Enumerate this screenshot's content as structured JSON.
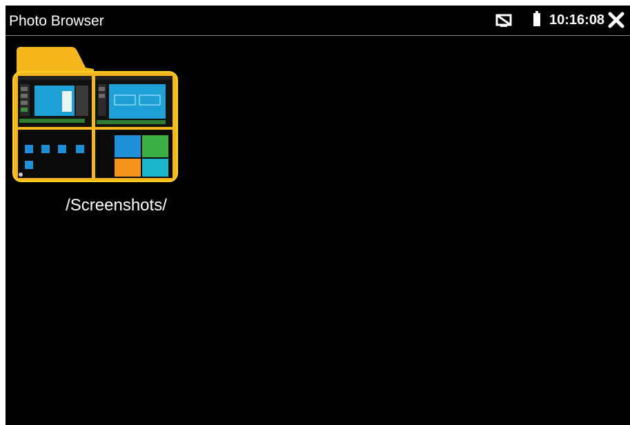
{
  "titlebar": {
    "title": "Photo Browser",
    "clock": "10:16:08",
    "icons": {
      "cast": "screen-cast-off-icon",
      "battery": "battery-icon",
      "close": "close-icon"
    }
  },
  "browser": {
    "folders": [
      {
        "label": "/Screenshots/",
        "icon": "folder-icon"
      }
    ]
  },
  "colors": {
    "background": "#000000",
    "folder": "#f6b71c",
    "folder_border": "#ffd21f",
    "text": "#ffffff",
    "divider": "#8a8a8a"
  }
}
